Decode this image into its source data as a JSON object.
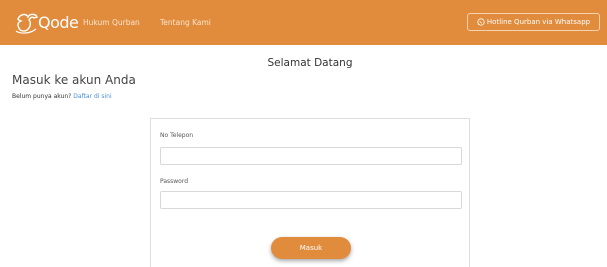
{
  "colors": {
    "brand": "#e18b3c",
    "link": "#4a8fd4"
  },
  "navbar": {
    "brand": "Qode",
    "links": [
      "Hukum Qurban",
      "Tentang Kami"
    ],
    "hotline": "Hotline Qurban via Whatsapp",
    "hotline_icon": "whatsapp-icon"
  },
  "main": {
    "welcome": "Selamat Datang",
    "heading": "Masuk ke akun Anda",
    "signup_prompt": "Belum punya akun?",
    "signup_link": "Daftar di sini"
  },
  "form": {
    "phone_label": "No Telepon",
    "phone_value": "",
    "password_label": "Password",
    "password_value": "",
    "submit_label": "Masuk"
  }
}
